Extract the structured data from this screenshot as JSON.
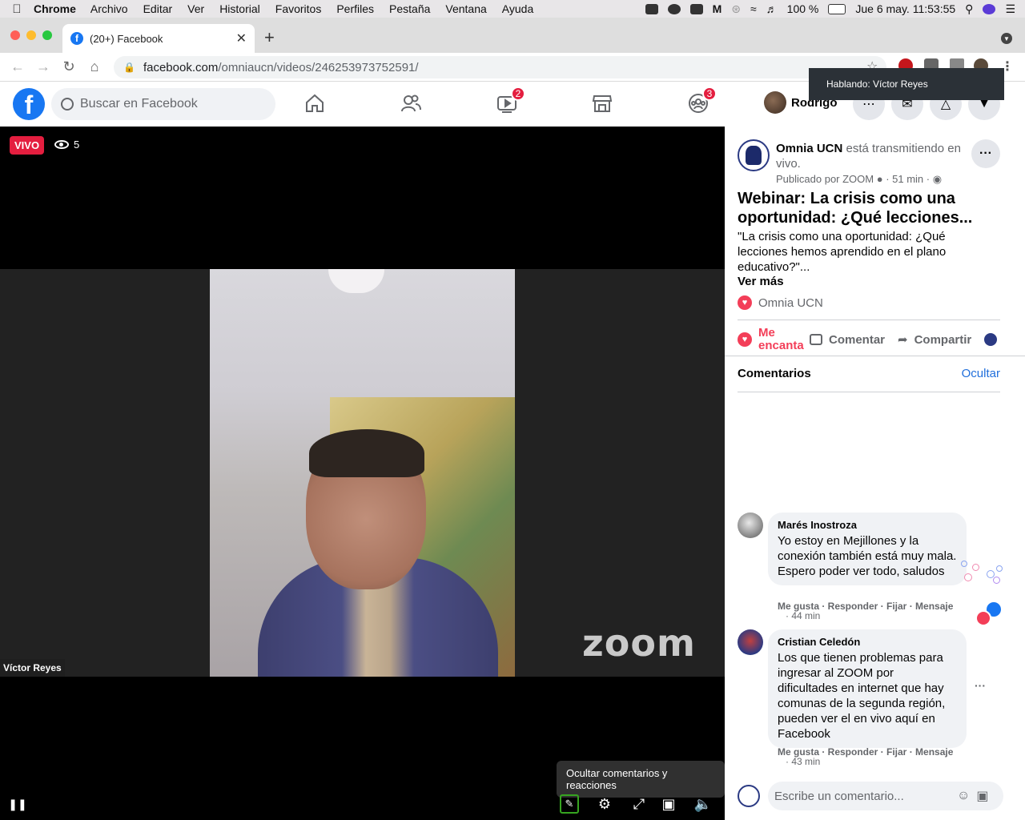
{
  "menubar": {
    "app": "Chrome",
    "menus": [
      "Archivo",
      "Editar",
      "Ver",
      "Historial",
      "Favoritos",
      "Perfiles",
      "Pestaña",
      "Ventana",
      "Ayuda"
    ],
    "battery": "100 %",
    "datetime": "Jue 6 may.  11:53:55"
  },
  "tab": {
    "title": "(20+) Facebook"
  },
  "address": {
    "host": "facebook.com",
    "path": "/omniaucn/videos/246253973752591/"
  },
  "speaking_tooltip": "Hablando: Víctor Reyes",
  "fbheader": {
    "search_placeholder": "Buscar en Facebook",
    "watch_badge": "2",
    "groups_badge": "3",
    "profile_name": "Rodrigo"
  },
  "video": {
    "live_label": "VIVO",
    "viewers": "5",
    "speaker_name": "Víctor Reyes",
    "zoom_logo": "zoom",
    "control_tooltip": "Ocultar comentarios y reacciones"
  },
  "post": {
    "page_name": "Omnia UCN",
    "status_text": " está transmitiendo en vivo.",
    "published_by": "Publicado por ZOOM",
    "time": "51 min",
    "title": "Webinar: La crisis como una oportunidad: ¿Qué lecciones...",
    "description": "\"La crisis como una oportunidad: ¿Qué lecciones hemos aprendido en el plano educativo?\"...",
    "see_more": "Ver más",
    "reactor": "Omnia UCN",
    "actions": {
      "love_line1": "Me",
      "love_line2": "encanta",
      "comment": "Comentar",
      "share": "Compartir"
    }
  },
  "comments_section": {
    "title": "Comentarios",
    "hide_label": "Ocultar",
    "items": [
      {
        "author": "Marés Inostroza",
        "text": "Yo estoy en Mejillones y la conexión también está muy mala. Espero poder ver todo, saludos",
        "links": "Me gusta · Responder · Fijar · Mensaje",
        "time": "· 44 min"
      },
      {
        "author": "Cristian Celedón",
        "text": "Los que tienen problemas para ingresar al ZOOM por dificultades en internet que hay comunas de la segunda región, pueden ver el en vivo aquí en Facebook",
        "links": "Me gusta · Responder · Fijar · Mensaje",
        "time": "· 43 min"
      }
    ],
    "composer_placeholder": "Escribe un comentario..."
  },
  "colors": {
    "fb_blue": "#1877f2",
    "live_red": "#e41e3f",
    "love_pink": "#f33e58",
    "link_blue": "#216fdb"
  }
}
